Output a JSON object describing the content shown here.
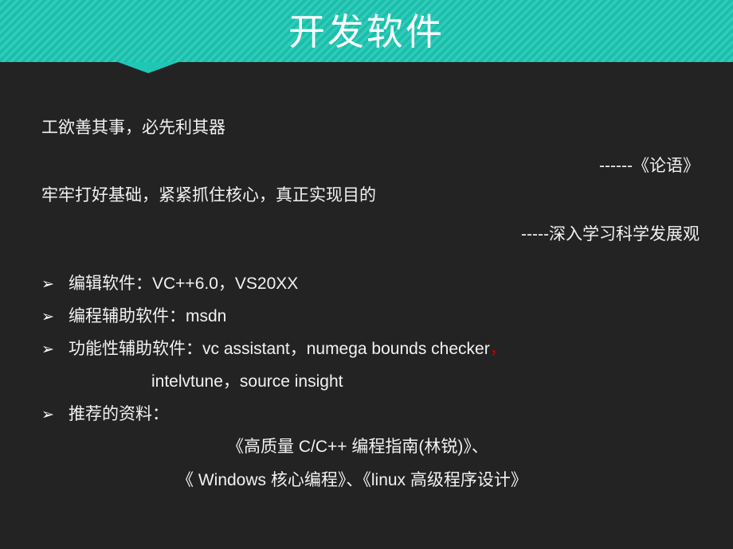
{
  "slide": {
    "title": "开发软件",
    "header_color": "#1ec8b4",
    "background_color": "#232323",
    "text_color": "#f2f2f2",
    "accent_color": "#c00000"
  },
  "quotes": [
    {
      "text": "工欲善其事，必先利其器",
      "attribution": "------《论语》"
    },
    {
      "text": "牢牢打好基础，紧紧抓住核心，真正实现目的",
      "attribution": "-----深入学习科学发展观"
    }
  ],
  "bullets": [
    {
      "marker": "➢",
      "text": "编辑软件：VC++6.0，VS20XX"
    },
    {
      "marker": "➢",
      "text": "编程辅助软件：msdn"
    },
    {
      "marker": "➢",
      "text": "功能性辅助软件：vc assistant，numega bounds checker",
      "trailing_mark": "，",
      "continuation": "intelvtune，source insight"
    },
    {
      "marker": "➢",
      "text": "推荐的资料："
    }
  ],
  "references": [
    "《高质量 C/C++ 编程指南(林锐)》、",
    "《 Windows 核心编程》、《linux 高级程序设计》"
  ]
}
